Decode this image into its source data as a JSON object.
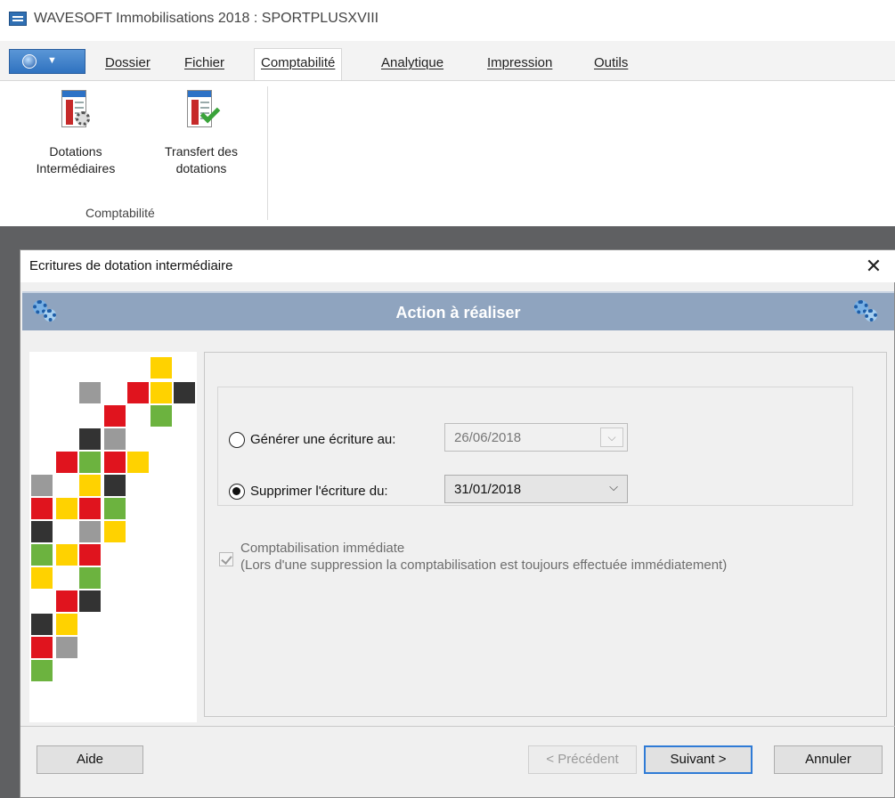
{
  "window": {
    "title": "WAVESOFT Immobilisations 2018 : SPORTPLUSXVIII"
  },
  "menu": {
    "items": [
      {
        "label": "Dossier"
      },
      {
        "label": "Fichier"
      },
      {
        "label": "Comptabilité",
        "active": true
      },
      {
        "label": "Analytique"
      },
      {
        "label": "Impression"
      },
      {
        "label": "Outils"
      }
    ]
  },
  "ribbon": {
    "buttons": [
      {
        "line1": "Dotations",
        "line2": "Intermédiaires",
        "icon": "dotations-gear-icon"
      },
      {
        "line1": "Transfert des",
        "line2": "dotations",
        "icon": "transfer-check-icon"
      }
    ],
    "group_label": "Comptabilité"
  },
  "dialog": {
    "title": "Ecritures de dotation intermédiaire",
    "close_glyph": "✕",
    "banner_title": "Action à réaliser",
    "option_generate": {
      "label": "Générer une écriture au:",
      "date": "26/06/2018",
      "selected": false,
      "enabled": false
    },
    "option_delete": {
      "label": "Supprimer l'écriture du:",
      "date": "31/01/2018",
      "selected": true,
      "enabled": true
    },
    "checkbox": {
      "label": "Comptabilisation immédiate",
      "note": "(Lors d'une suppression la comptabilisation est toujours effectuée immédiatement)",
      "checked": true,
      "enabled": false
    },
    "buttons": {
      "help": "Aide",
      "previous": "< Précédent",
      "next": "Suivant >",
      "cancel": "Annuler"
    }
  },
  "colors": {
    "banner": "#8fa4bf",
    "accent_blue": "#2f7bd6",
    "mosaic_yellow": "#ffd200",
    "mosaic_red": "#e0141e",
    "mosaic_green": "#6cb33f",
    "mosaic_dark": "#333333",
    "mosaic_gray": "#9a9a9a"
  }
}
